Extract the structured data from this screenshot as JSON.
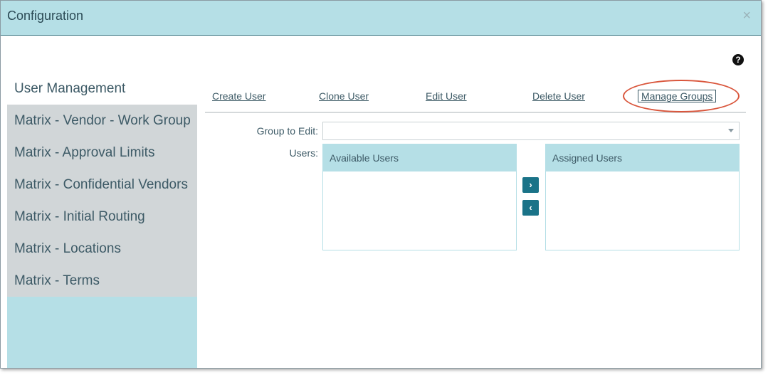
{
  "dialog": {
    "title": "Configuration",
    "close_icon": "×",
    "help_icon": "?"
  },
  "sidebar": {
    "items": [
      {
        "label": "User Management",
        "active": true
      },
      {
        "label": "Matrix - Vendor - Work Group",
        "active": false
      },
      {
        "label": "Matrix - Approval Limits",
        "active": false
      },
      {
        "label": "Matrix - Confidential Vendors",
        "active": false
      },
      {
        "label": "Matrix - Initial Routing",
        "active": false
      },
      {
        "label": "Matrix - Locations",
        "active": false
      },
      {
        "label": "Matrix - Terms",
        "active": false
      }
    ]
  },
  "actions": {
    "create_user": "Create User",
    "clone_user": "Clone User",
    "edit_user": "Edit User",
    "delete_user": "Delete User",
    "manage_groups": "Manage Groups"
  },
  "form": {
    "group_label": "Group to Edit:",
    "group_value": "",
    "users_label": "Users:",
    "available_header": "Available Users",
    "assigned_header": "Assigned Users",
    "move_right_icon": "›",
    "move_left_icon": "‹"
  },
  "colors": {
    "header_bg": "#b5dfe6",
    "sidebar_bg": "#b5dfe6",
    "nav_item_bg": "#d1d6d8",
    "text": "#3d5a66",
    "button_bg": "#1a7388",
    "highlight_ring": "#d9553b"
  }
}
